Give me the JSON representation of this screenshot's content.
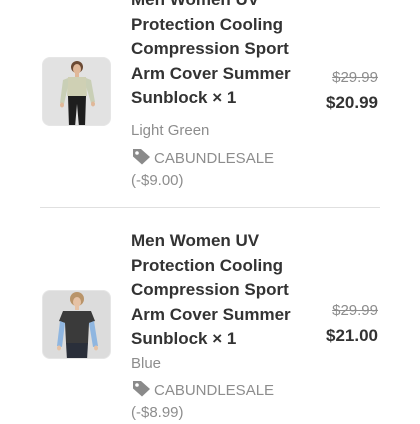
{
  "items": [
    {
      "title": "Men Women UV Protection Cooling Compression Sport Arm Cover Summer Sunblock × 1",
      "variant": "Light Green",
      "discount": "CABUNDLESALE (-$9.00)",
      "original_price": "$29.99",
      "price": "$20.99",
      "thumbnail_icon": "product-thumbnail"
    },
    {
      "title": "Men Women UV Protection Cooling Compression Sport Arm Cover Summer Sunblock × 1",
      "variant": "Blue",
      "discount": "CABUNDLESALE (-$8.99)",
      "original_price": "$29.99",
      "price": "$21.00",
      "thumbnail_icon": "product-thumbnail"
    }
  ],
  "colors": {
    "text_primary": "#333333",
    "text_secondary": "#8d8d8d",
    "divider": "#e0e0e0",
    "tag_icon": "#8a8a8a"
  }
}
